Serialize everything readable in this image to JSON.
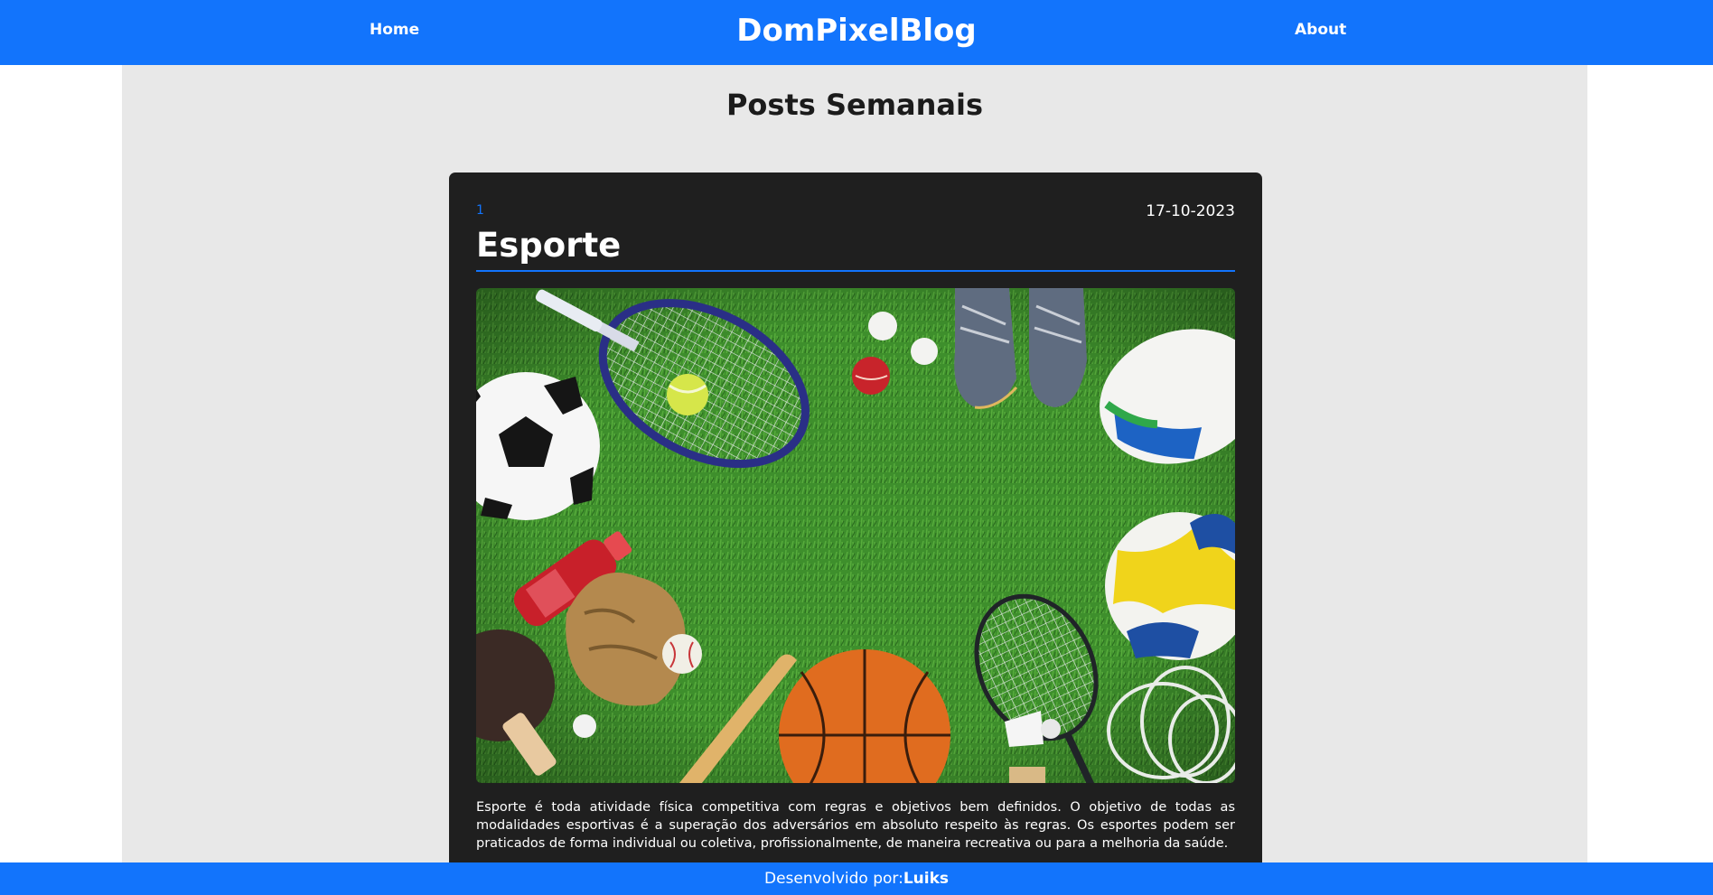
{
  "header": {
    "nav_home": "Home",
    "brand": "DomPixelBlog",
    "nav_about": "About"
  },
  "main": {
    "title": "Posts Semanais"
  },
  "post": {
    "number": "1",
    "date": "17-10-2023",
    "title": "Esporte",
    "image_subject": "sports-equipment-on-grass",
    "text": "Esporte é toda atividade física competitiva com regras e objetivos bem definidos. O objetivo de todas as modalidades esportivas é a superação dos adversários em absoluto respeito às regras. Os esportes podem ser praticados de forma individual ou coletiva, profissionalmente, de maneira recreativa ou para a melhoria da saúde."
  },
  "footer": {
    "label": "Desenvolvido por:",
    "author": "Luiks"
  },
  "colors": {
    "primary": "#1274fc",
    "page_bg": "#e8e8e8",
    "card_bg": "#1f1f1f"
  }
}
